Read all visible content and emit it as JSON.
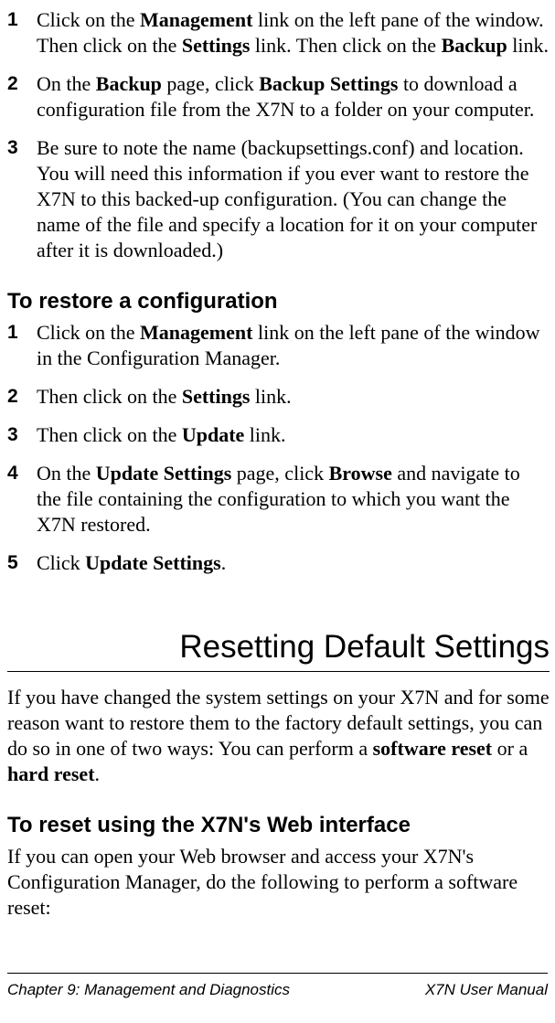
{
  "listA": {
    "items": [
      {
        "num": "1",
        "parts": [
          {
            "t": "Click on the ",
            "b": false
          },
          {
            "t": "Management",
            "b": true
          },
          {
            "t": " link on the left pane of the window. Then click on the ",
            "b": false
          },
          {
            "t": "Settings",
            "b": true
          },
          {
            "t": " link.  Then click on the ",
            "b": false
          },
          {
            "t": "Backup",
            "b": true
          },
          {
            "t": " link.",
            "b": false
          }
        ]
      },
      {
        "num": "2",
        "parts": [
          {
            "t": "On the ",
            "b": false
          },
          {
            "t": "Backup",
            "b": true
          },
          {
            "t": " page, click ",
            "b": false
          },
          {
            "t": "Backup Settings",
            "b": true
          },
          {
            "t": " to download a configuration file from the X7N to a folder on your computer.",
            "b": false
          }
        ]
      },
      {
        "num": "3",
        "parts": [
          {
            "t": "Be sure to note the name (backupsettings.conf) and location. You will need this information if you ever want to restore the X7N to this backed-up configuration.  (You can change the name of the file and specify a location for it on your computer after it is downloaded.)",
            "b": false
          }
        ]
      }
    ]
  },
  "subheadB": "To restore a configuration",
  "listB": {
    "items": [
      {
        "num": "1",
        "parts": [
          {
            "t": "Click on the ",
            "b": false
          },
          {
            "t": "Management",
            "b": true
          },
          {
            "t": " link on the left pane of the window in the Configuration Manager.",
            "b": false
          }
        ]
      },
      {
        "num": "2",
        "parts": [
          {
            "t": "Then click on the ",
            "b": false
          },
          {
            "t": "Settings",
            "b": true
          },
          {
            "t": " link.",
            "b": false
          }
        ]
      },
      {
        "num": "3",
        "parts": [
          {
            "t": "Then click on the ",
            "b": false
          },
          {
            "t": "Update",
            "b": true
          },
          {
            "t": " link.",
            "b": false
          }
        ]
      },
      {
        "num": "4",
        "parts": [
          {
            "t": "On the ",
            "b": false
          },
          {
            "t": "Update Settings",
            "b": true
          },
          {
            "t": " page, click ",
            "b": false
          },
          {
            "t": "Browse",
            "b": true
          },
          {
            "t": " and navigate to the file containing the configuration to which you want the X7N restored.",
            "b": false
          }
        ]
      },
      {
        "num": "5",
        "parts": [
          {
            "t": "Click ",
            "b": false
          },
          {
            "t": "Update Settings",
            "b": true
          },
          {
            "t": ".",
            "b": false
          }
        ]
      }
    ]
  },
  "sectionTitle": "Resetting Default Settings",
  "paraC": {
    "parts": [
      {
        "t": "If you have changed the system settings on your X7N and for some reason want to restore them to the factory default settings, you can do so in one of two ways: You can perform a ",
        "b": false
      },
      {
        "t": "software reset",
        "b": true
      },
      {
        "t": " or a ",
        "b": false
      },
      {
        "t": "hard reset",
        "b": true
      },
      {
        "t": ".",
        "b": false
      }
    ]
  },
  "subheadD": "To reset using the X7N's Web interface",
  "paraD": {
    "parts": [
      {
        "t": "If you can open your Web browser and access your X7N's Configuration Manager, do the following to perform a software reset:",
        "b": false
      }
    ]
  },
  "footer": {
    "left": "Chapter 9: Management and Diagnostics",
    "right": "X7N User Manual"
  }
}
